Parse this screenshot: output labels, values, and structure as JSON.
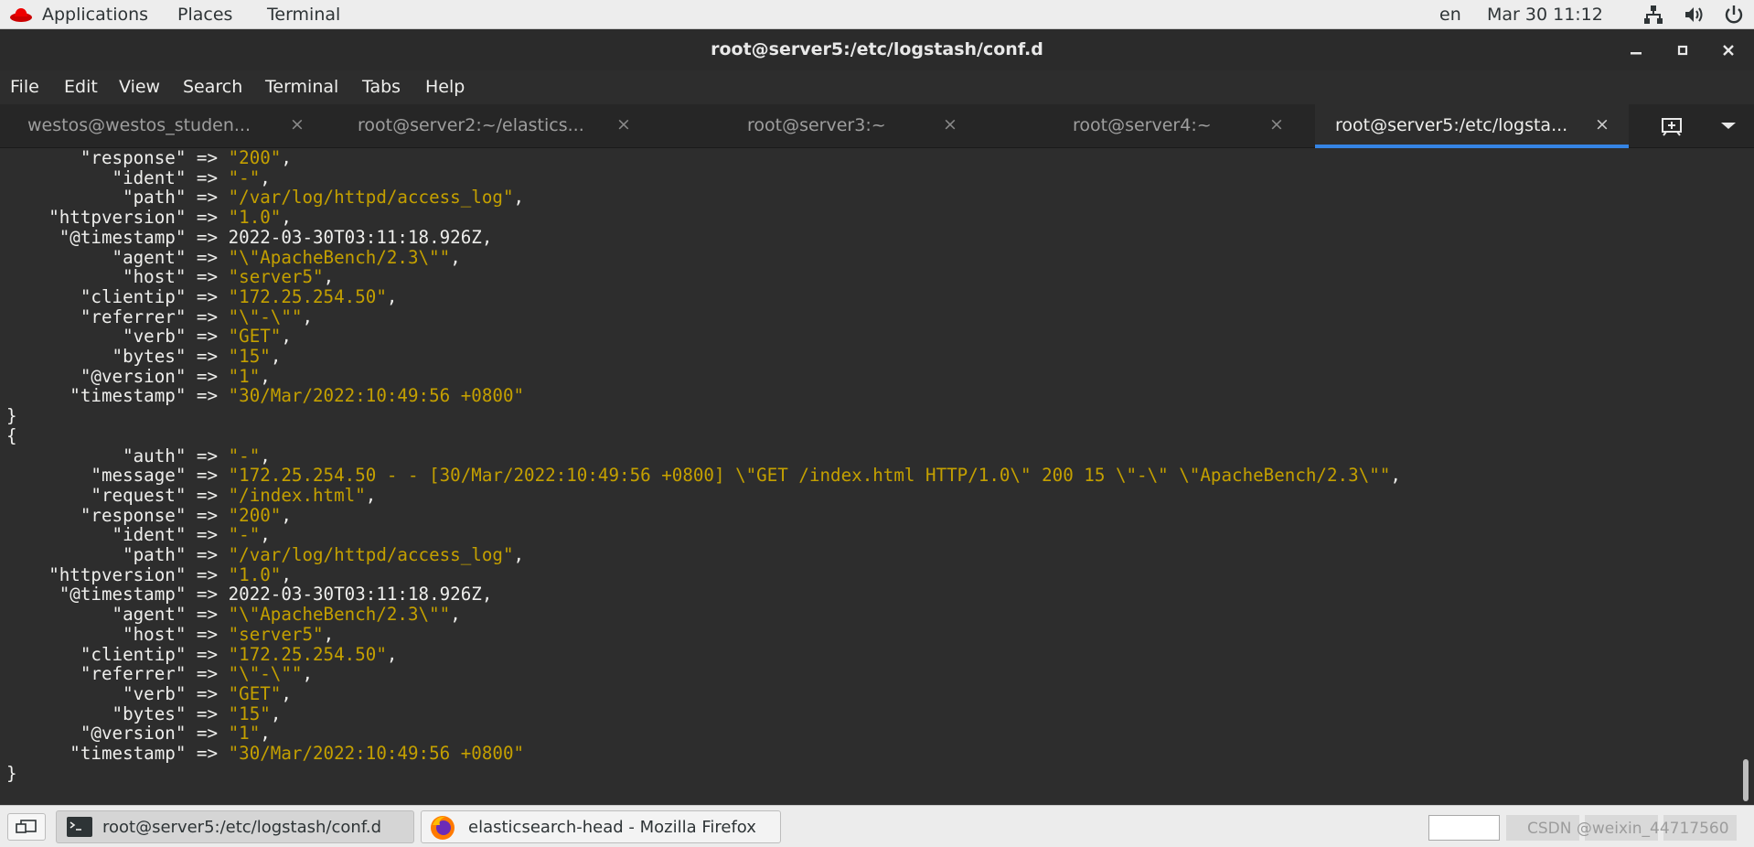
{
  "top_panel": {
    "applications": "Applications",
    "places": "Places",
    "terminal": "Terminal",
    "lang": "en",
    "datetime": "Mar 30  11:12",
    "icons": [
      "redhat-icon",
      "network-icon",
      "volume-icon",
      "power-icon"
    ]
  },
  "window": {
    "title": "root@server5:/etc/logstash/conf.d",
    "controls": [
      "minimize-icon",
      "maximize-icon",
      "close-icon"
    ]
  },
  "menubar": [
    "File",
    "Edit",
    "View",
    "Search",
    "Terminal",
    "Tabs",
    "Help"
  ],
  "tabs": [
    {
      "label": "westos@westos_studen...",
      "active": false
    },
    {
      "label": "root@server2:~/elastics...",
      "active": false
    },
    {
      "label": "root@server3:~",
      "active": false
    },
    {
      "label": "root@server4:~",
      "active": false
    },
    {
      "label": "root@server5:/etc/logsta...",
      "active": true
    }
  ],
  "tab_close_glyph": "×",
  "terminal_lines": [
    {
      "k": "       \"response\" => ",
      "v": "\"200\"",
      "t": ","
    },
    {
      "k": "          \"ident\" => ",
      "v": "\"-\"",
      "t": ","
    },
    {
      "k": "           \"path\" => ",
      "v": "\"/var/log/httpd/access_log\"",
      "t": ","
    },
    {
      "k": "    \"httpversion\" => ",
      "v": "\"1.0\"",
      "t": ","
    },
    {
      "k": "     \"@timestamp\" => 2022-03-30T03:11:18.926Z,",
      "v": "",
      "t": ""
    },
    {
      "k": "          \"agent\" => ",
      "v": "\"\\\"ApacheBench/2.3\\\"\"",
      "t": ","
    },
    {
      "k": "           \"host\" => ",
      "v": "\"server5\"",
      "t": ","
    },
    {
      "k": "       \"clientip\" => ",
      "v": "\"172.25.254.50\"",
      "t": ","
    },
    {
      "k": "       \"referrer\" => ",
      "v": "\"\\\"-\\\"\"",
      "t": ","
    },
    {
      "k": "           \"verb\" => ",
      "v": "\"GET\"",
      "t": ","
    },
    {
      "k": "          \"bytes\" => ",
      "v": "\"15\"",
      "t": ","
    },
    {
      "k": "       \"@version\" => ",
      "v": "\"1\"",
      "t": ","
    },
    {
      "k": "      \"timestamp\" => ",
      "v": "\"30/Mar/2022:10:49:56 +0800\"",
      "t": ""
    },
    {
      "k": "}",
      "v": "",
      "t": ""
    },
    {
      "k": "{",
      "v": "",
      "t": ""
    },
    {
      "k": "           \"auth\" => ",
      "v": "\"-\"",
      "t": ","
    },
    {
      "k": "        \"message\" => ",
      "v": "\"172.25.254.50 - - [30/Mar/2022:10:49:56 +0800] \\\"GET /index.html HTTP/1.0\\\" 200 15 \\\"-\\\" \\\"ApacheBench/2.3\\\"\"",
      "t": ","
    },
    {
      "k": "        \"request\" => ",
      "v": "\"/index.html\"",
      "t": ","
    },
    {
      "k": "       \"response\" => ",
      "v": "\"200\"",
      "t": ","
    },
    {
      "k": "          \"ident\" => ",
      "v": "\"-\"",
      "t": ","
    },
    {
      "k": "           \"path\" => ",
      "v": "\"/var/log/httpd/access_log\"",
      "t": ","
    },
    {
      "k": "    \"httpversion\" => ",
      "v": "\"1.0\"",
      "t": ","
    },
    {
      "k": "     \"@timestamp\" => 2022-03-30T03:11:18.926Z,",
      "v": "",
      "t": ""
    },
    {
      "k": "          \"agent\" => ",
      "v": "\"\\\"ApacheBench/2.3\\\"\"",
      "t": ","
    },
    {
      "k": "           \"host\" => ",
      "v": "\"server5\"",
      "t": ","
    },
    {
      "k": "       \"clientip\" => ",
      "v": "\"172.25.254.50\"",
      "t": ","
    },
    {
      "k": "       \"referrer\" => ",
      "v": "\"\\\"-\\\"\"",
      "t": ","
    },
    {
      "k": "           \"verb\" => ",
      "v": "\"GET\"",
      "t": ","
    },
    {
      "k": "          \"bytes\" => ",
      "v": "\"15\"",
      "t": ","
    },
    {
      "k": "       \"@version\" => ",
      "v": "\"1\"",
      "t": ","
    },
    {
      "k": "      \"timestamp\" => ",
      "v": "\"30/Mar/2022:10:49:56 +0800\"",
      "t": ""
    },
    {
      "k": "}",
      "v": "",
      "t": ""
    }
  ],
  "taskbar": {
    "tasks": [
      {
        "label": "root@server5:/etc/logstash/conf.d",
        "icon": "terminal-icon",
        "active": true
      },
      {
        "label": "elasticsearch-head - Mozilla Firefox",
        "icon": "firefox-icon",
        "active": false
      }
    ],
    "watermark": "CSDN @weixin_44717560"
  },
  "colors": {
    "terminal_bg": "#2d2d2d",
    "terminal_fg": "#eeeeec",
    "string_value": "#c4a000",
    "active_tab_accent": "#3584e4"
  }
}
